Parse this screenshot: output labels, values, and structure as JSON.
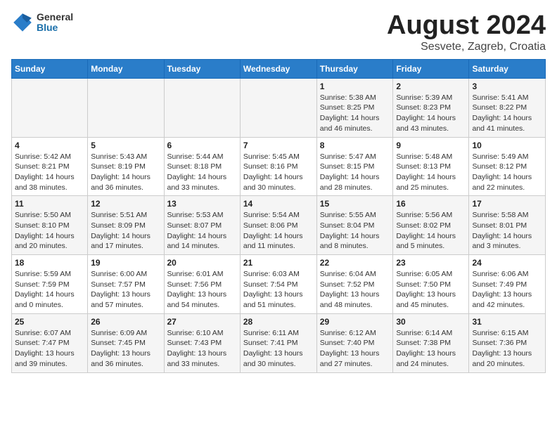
{
  "header": {
    "logo_general": "General",
    "logo_blue": "Blue",
    "month_year": "August 2024",
    "location": "Sesvete, Zagreb, Croatia"
  },
  "days_of_week": [
    "Sunday",
    "Monday",
    "Tuesday",
    "Wednesday",
    "Thursday",
    "Friday",
    "Saturday"
  ],
  "weeks": [
    [
      {
        "day": "",
        "info": ""
      },
      {
        "day": "",
        "info": ""
      },
      {
        "day": "",
        "info": ""
      },
      {
        "day": "",
        "info": ""
      },
      {
        "day": "1",
        "info": "Sunrise: 5:38 AM\nSunset: 8:25 PM\nDaylight: 14 hours\nand 46 minutes."
      },
      {
        "day": "2",
        "info": "Sunrise: 5:39 AM\nSunset: 8:23 PM\nDaylight: 14 hours\nand 43 minutes."
      },
      {
        "day": "3",
        "info": "Sunrise: 5:41 AM\nSunset: 8:22 PM\nDaylight: 14 hours\nand 41 minutes."
      }
    ],
    [
      {
        "day": "4",
        "info": "Sunrise: 5:42 AM\nSunset: 8:21 PM\nDaylight: 14 hours\nand 38 minutes."
      },
      {
        "day": "5",
        "info": "Sunrise: 5:43 AM\nSunset: 8:19 PM\nDaylight: 14 hours\nand 36 minutes."
      },
      {
        "day": "6",
        "info": "Sunrise: 5:44 AM\nSunset: 8:18 PM\nDaylight: 14 hours\nand 33 minutes."
      },
      {
        "day": "7",
        "info": "Sunrise: 5:45 AM\nSunset: 8:16 PM\nDaylight: 14 hours\nand 30 minutes."
      },
      {
        "day": "8",
        "info": "Sunrise: 5:47 AM\nSunset: 8:15 PM\nDaylight: 14 hours\nand 28 minutes."
      },
      {
        "day": "9",
        "info": "Sunrise: 5:48 AM\nSunset: 8:13 PM\nDaylight: 14 hours\nand 25 minutes."
      },
      {
        "day": "10",
        "info": "Sunrise: 5:49 AM\nSunset: 8:12 PM\nDaylight: 14 hours\nand 22 minutes."
      }
    ],
    [
      {
        "day": "11",
        "info": "Sunrise: 5:50 AM\nSunset: 8:10 PM\nDaylight: 14 hours\nand 20 minutes."
      },
      {
        "day": "12",
        "info": "Sunrise: 5:51 AM\nSunset: 8:09 PM\nDaylight: 14 hours\nand 17 minutes."
      },
      {
        "day": "13",
        "info": "Sunrise: 5:53 AM\nSunset: 8:07 PM\nDaylight: 14 hours\nand 14 minutes."
      },
      {
        "day": "14",
        "info": "Sunrise: 5:54 AM\nSunset: 8:06 PM\nDaylight: 14 hours\nand 11 minutes."
      },
      {
        "day": "15",
        "info": "Sunrise: 5:55 AM\nSunset: 8:04 PM\nDaylight: 14 hours\nand 8 minutes."
      },
      {
        "day": "16",
        "info": "Sunrise: 5:56 AM\nSunset: 8:02 PM\nDaylight: 14 hours\nand 5 minutes."
      },
      {
        "day": "17",
        "info": "Sunrise: 5:58 AM\nSunset: 8:01 PM\nDaylight: 14 hours\nand 3 minutes."
      }
    ],
    [
      {
        "day": "18",
        "info": "Sunrise: 5:59 AM\nSunset: 7:59 PM\nDaylight: 14 hours\nand 0 minutes."
      },
      {
        "day": "19",
        "info": "Sunrise: 6:00 AM\nSunset: 7:57 PM\nDaylight: 13 hours\nand 57 minutes."
      },
      {
        "day": "20",
        "info": "Sunrise: 6:01 AM\nSunset: 7:56 PM\nDaylight: 13 hours\nand 54 minutes."
      },
      {
        "day": "21",
        "info": "Sunrise: 6:03 AM\nSunset: 7:54 PM\nDaylight: 13 hours\nand 51 minutes."
      },
      {
        "day": "22",
        "info": "Sunrise: 6:04 AM\nSunset: 7:52 PM\nDaylight: 13 hours\nand 48 minutes."
      },
      {
        "day": "23",
        "info": "Sunrise: 6:05 AM\nSunset: 7:50 PM\nDaylight: 13 hours\nand 45 minutes."
      },
      {
        "day": "24",
        "info": "Sunrise: 6:06 AM\nSunset: 7:49 PM\nDaylight: 13 hours\nand 42 minutes."
      }
    ],
    [
      {
        "day": "25",
        "info": "Sunrise: 6:07 AM\nSunset: 7:47 PM\nDaylight: 13 hours\nand 39 minutes."
      },
      {
        "day": "26",
        "info": "Sunrise: 6:09 AM\nSunset: 7:45 PM\nDaylight: 13 hours\nand 36 minutes."
      },
      {
        "day": "27",
        "info": "Sunrise: 6:10 AM\nSunset: 7:43 PM\nDaylight: 13 hours\nand 33 minutes."
      },
      {
        "day": "28",
        "info": "Sunrise: 6:11 AM\nSunset: 7:41 PM\nDaylight: 13 hours\nand 30 minutes."
      },
      {
        "day": "29",
        "info": "Sunrise: 6:12 AM\nSunset: 7:40 PM\nDaylight: 13 hours\nand 27 minutes."
      },
      {
        "day": "30",
        "info": "Sunrise: 6:14 AM\nSunset: 7:38 PM\nDaylight: 13 hours\nand 24 minutes."
      },
      {
        "day": "31",
        "info": "Sunrise: 6:15 AM\nSunset: 7:36 PM\nDaylight: 13 hours\nand 20 minutes."
      }
    ]
  ]
}
